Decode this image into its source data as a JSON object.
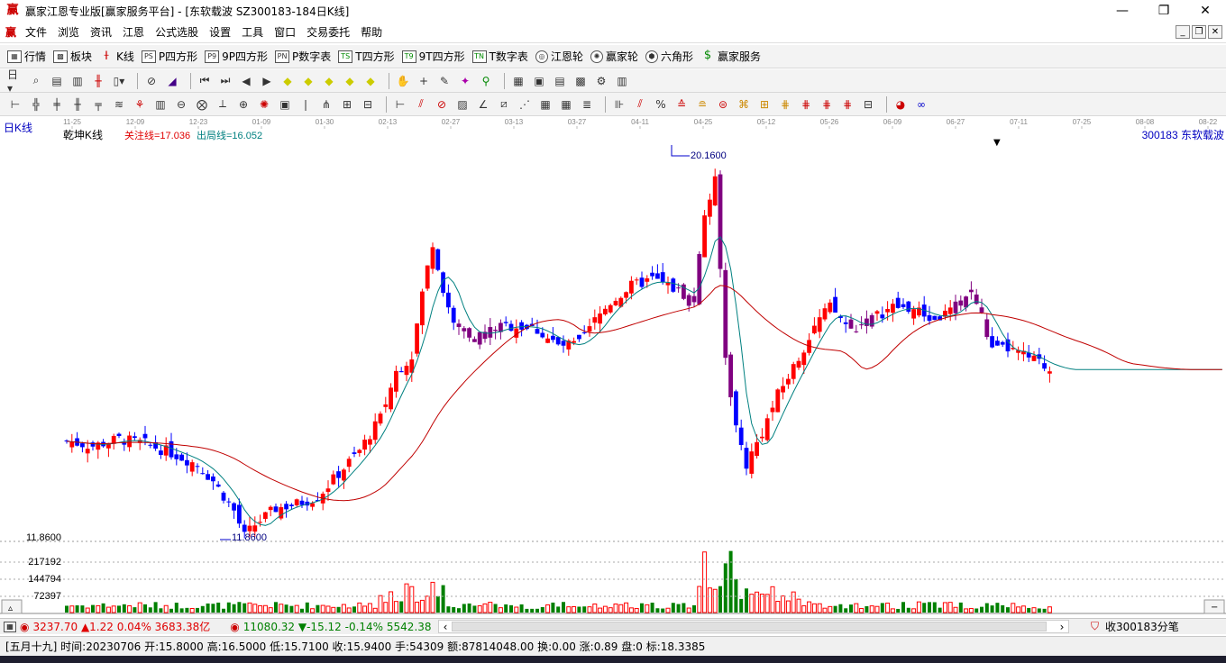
{
  "window": {
    "title": "赢家江恩专业版[赢家服务平台] - [东软载波  SZ300183-184日K线]",
    "app_icon": "赢",
    "buttons": [
      "minimize-icon",
      "restore-icon",
      "close-icon"
    ]
  },
  "menu": {
    "logo": "赢",
    "items": [
      "文件",
      "浏览",
      "资讯",
      "江恩",
      "公式选股",
      "设置",
      "工具",
      "窗口",
      "交易委托",
      "帮助"
    ]
  },
  "toolbar1": [
    {
      "icon": "grid-icon",
      "label": "行情"
    },
    {
      "icon": "blocks-icon",
      "label": "板块"
    },
    {
      "icon": "candle-icon",
      "label": "K线"
    },
    {
      "icon": "ps-icon",
      "label": "P四方形"
    },
    {
      "icon": "p9-icon",
      "label": "9P四方形"
    },
    {
      "icon": "pn-icon",
      "label": "P数字表"
    },
    {
      "icon": "ts-icon",
      "label": "T四方形"
    },
    {
      "icon": "t9-icon",
      "label": "9T四方形"
    },
    {
      "icon": "tn-icon",
      "label": "T数字表"
    },
    {
      "icon": "wheel-icon",
      "label": "江恩轮"
    },
    {
      "icon": "winner-wheel-icon",
      "label": "赢家轮"
    },
    {
      "icon": "hexagon-icon",
      "label": "六角形"
    },
    {
      "icon": "dollar-icon",
      "label": "赢家服务"
    }
  ],
  "chart": {
    "period_label": "日K线",
    "indicator_name": "乾坤K线",
    "focus_line": "关注线=17.036",
    "exit_line": "出局线=16.052",
    "stock_label": "300183  东软载波",
    "date_ticks": [
      "11-25",
      "12-09",
      "12-23",
      "01-09",
      "01-30",
      "02-13",
      "02-27",
      "03-13",
      "03-27",
      "04-11",
      "04-25",
      "05-12",
      "05-26",
      "06-09",
      "06-27",
      "07-11",
      "07-25",
      "08-08",
      "08-22"
    ],
    "high_label": "20.1600",
    "low_label": "11.8600",
    "low_axis": "11.8600",
    "volume_ticks": [
      "217192",
      "144794",
      "72397"
    ],
    "colors": {
      "up": "#ff0000",
      "down": "#0000ff",
      "highlight": "#800080",
      "ma_short": "#008080",
      "ma_long": "#c00000",
      "volume_up": "#ff0000",
      "volume_down": "#008000"
    }
  },
  "status1": {
    "sh_index": "3237.70",
    "sh_change": "▲1.22",
    "sh_pct": "0.04%",
    "sh_amount": "3683.38亿",
    "sz_index": "11080.32",
    "sz_change": "▼-15.12",
    "sz_pct": "-0.14%",
    "sz_amount": "5542.38",
    "collect": "收300183分笔"
  },
  "status2": {
    "info": "[五月十九] 时间:20230706 开:15.8000 高:16.5000 低:15.7100 收:15.9400 手:54309 额:87814048.00 换:0.00 涨:0.89 盘:0 标:18.3385"
  }
}
